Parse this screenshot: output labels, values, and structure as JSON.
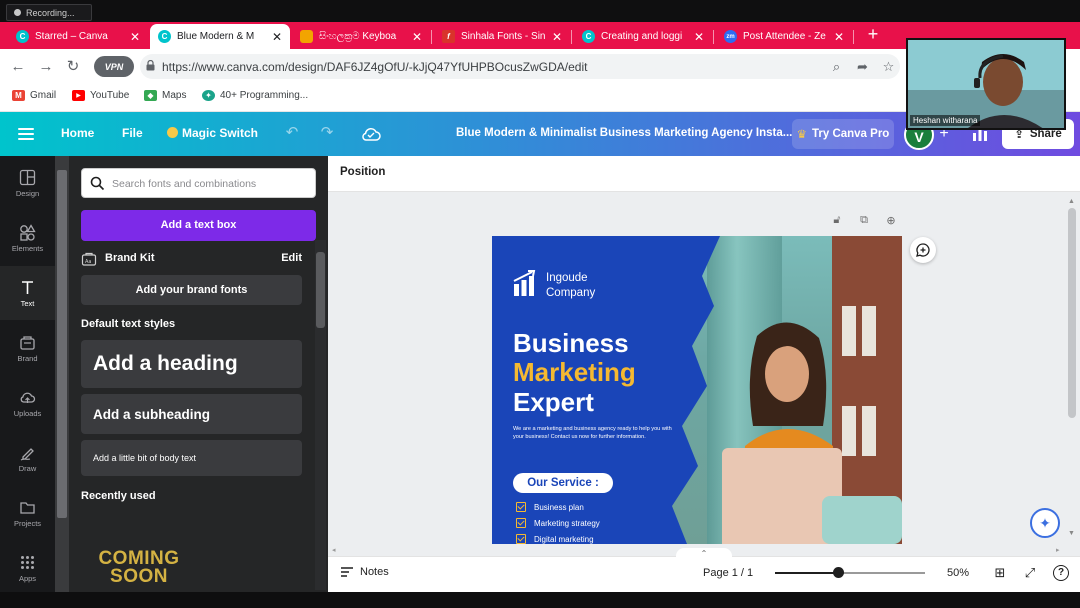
{
  "recording": {
    "label": "Recording..."
  },
  "tabs": [
    {
      "title": "Starred – Canva",
      "favicon_color": "#00c4cc",
      "favicon_glyph": "C"
    },
    {
      "title": "Blue Modern & M",
      "favicon_color": "#00c4cc",
      "favicon_glyph": "C",
      "active": true
    },
    {
      "title": "සිංහලක්‍රම Keyboa",
      "favicon_color": "#f2a400",
      "favicon_glyph": ""
    },
    {
      "title": "Sinhala Fonts - Sin",
      "favicon_color": "#d9332b",
      "favicon_glyph": "f"
    },
    {
      "title": "Creating and loggi",
      "favicon_color": "#00c4cc",
      "favicon_glyph": "C"
    },
    {
      "title": "Post Attendee - Ze",
      "favicon_color": "#2d6cf3",
      "favicon_glyph": "zm"
    }
  ],
  "browser": {
    "vpn_label": "VPN",
    "url": "https://www.canva.com/design/DAF6JZ4gOfU/-kJjQ47YfUHPBOcusZwGDA/edit",
    "bookmarks": [
      {
        "label": "Gmail",
        "icon": "gmail-icon",
        "color": "#ea4335",
        "glyph": "M"
      },
      {
        "label": "YouTube",
        "icon": "youtube-icon",
        "color": "#ff0000",
        "glyph": "▶"
      },
      {
        "label": "Maps",
        "icon": "maps-icon",
        "color": "#34a853",
        "glyph": "◆"
      },
      {
        "label": "40+ Programming...",
        "icon": "programming-icon",
        "color": "#1aa38a",
        "glyph": "✦"
      }
    ]
  },
  "webcam": {
    "name": "Heshan witharana"
  },
  "canva": {
    "nav": {
      "home": "Home",
      "file": "File",
      "magic_switch": "Magic Switch"
    },
    "doc_title": "Blue Modern & Minimalist Business Marketing Agency Insta...",
    "try_pro": "Try Canva Pro",
    "avatar_letter": "V",
    "share": "Share",
    "rail": [
      {
        "label": "Design",
        "icon": "design-icon"
      },
      {
        "label": "Elements",
        "icon": "elements-icon"
      },
      {
        "label": "Text",
        "icon": "text-icon",
        "active": true
      },
      {
        "label": "Brand",
        "icon": "brand-icon"
      },
      {
        "label": "Uploads",
        "icon": "uploads-icon"
      },
      {
        "label": "Draw",
        "icon": "draw-icon"
      },
      {
        "label": "Projects",
        "icon": "projects-icon"
      },
      {
        "label": "Apps",
        "icon": "apps-icon"
      }
    ],
    "panel": {
      "search_placeholder": "Search fonts and combinations",
      "add_text_box": "Add a text box",
      "brand_kit": "Brand Kit",
      "brand_kit_edit": "Edit",
      "add_brand_fonts": "Add your brand fonts",
      "default_styles_heading": "Default text styles",
      "heading": "Add a heading",
      "subheading": "Add a subheading",
      "body": "Add a little bit of body text",
      "recently_used": "Recently used",
      "recent_sample_line1": "COMING",
      "recent_sample_line2": "SOON"
    },
    "toolbar": {
      "position": "Position"
    },
    "design": {
      "company_line1": "Ingoude",
      "company_line2": "Company",
      "headline_1": "Business",
      "headline_2": "Marketing",
      "headline_3": "Expert",
      "description": "We are a marketing and business agency ready to help you with your business! Contact us now for further information.",
      "service_label": "Our Service :",
      "services": [
        "Business plan",
        "Marketing strategy",
        "Digital marketing"
      ],
      "colors": {
        "background": "#1a45b8",
        "accent": "#f5b931"
      }
    },
    "bottom": {
      "notes": "Notes",
      "page": "Page 1 / 1",
      "zoom": "50%",
      "zoom_fraction": 0.5
    }
  }
}
